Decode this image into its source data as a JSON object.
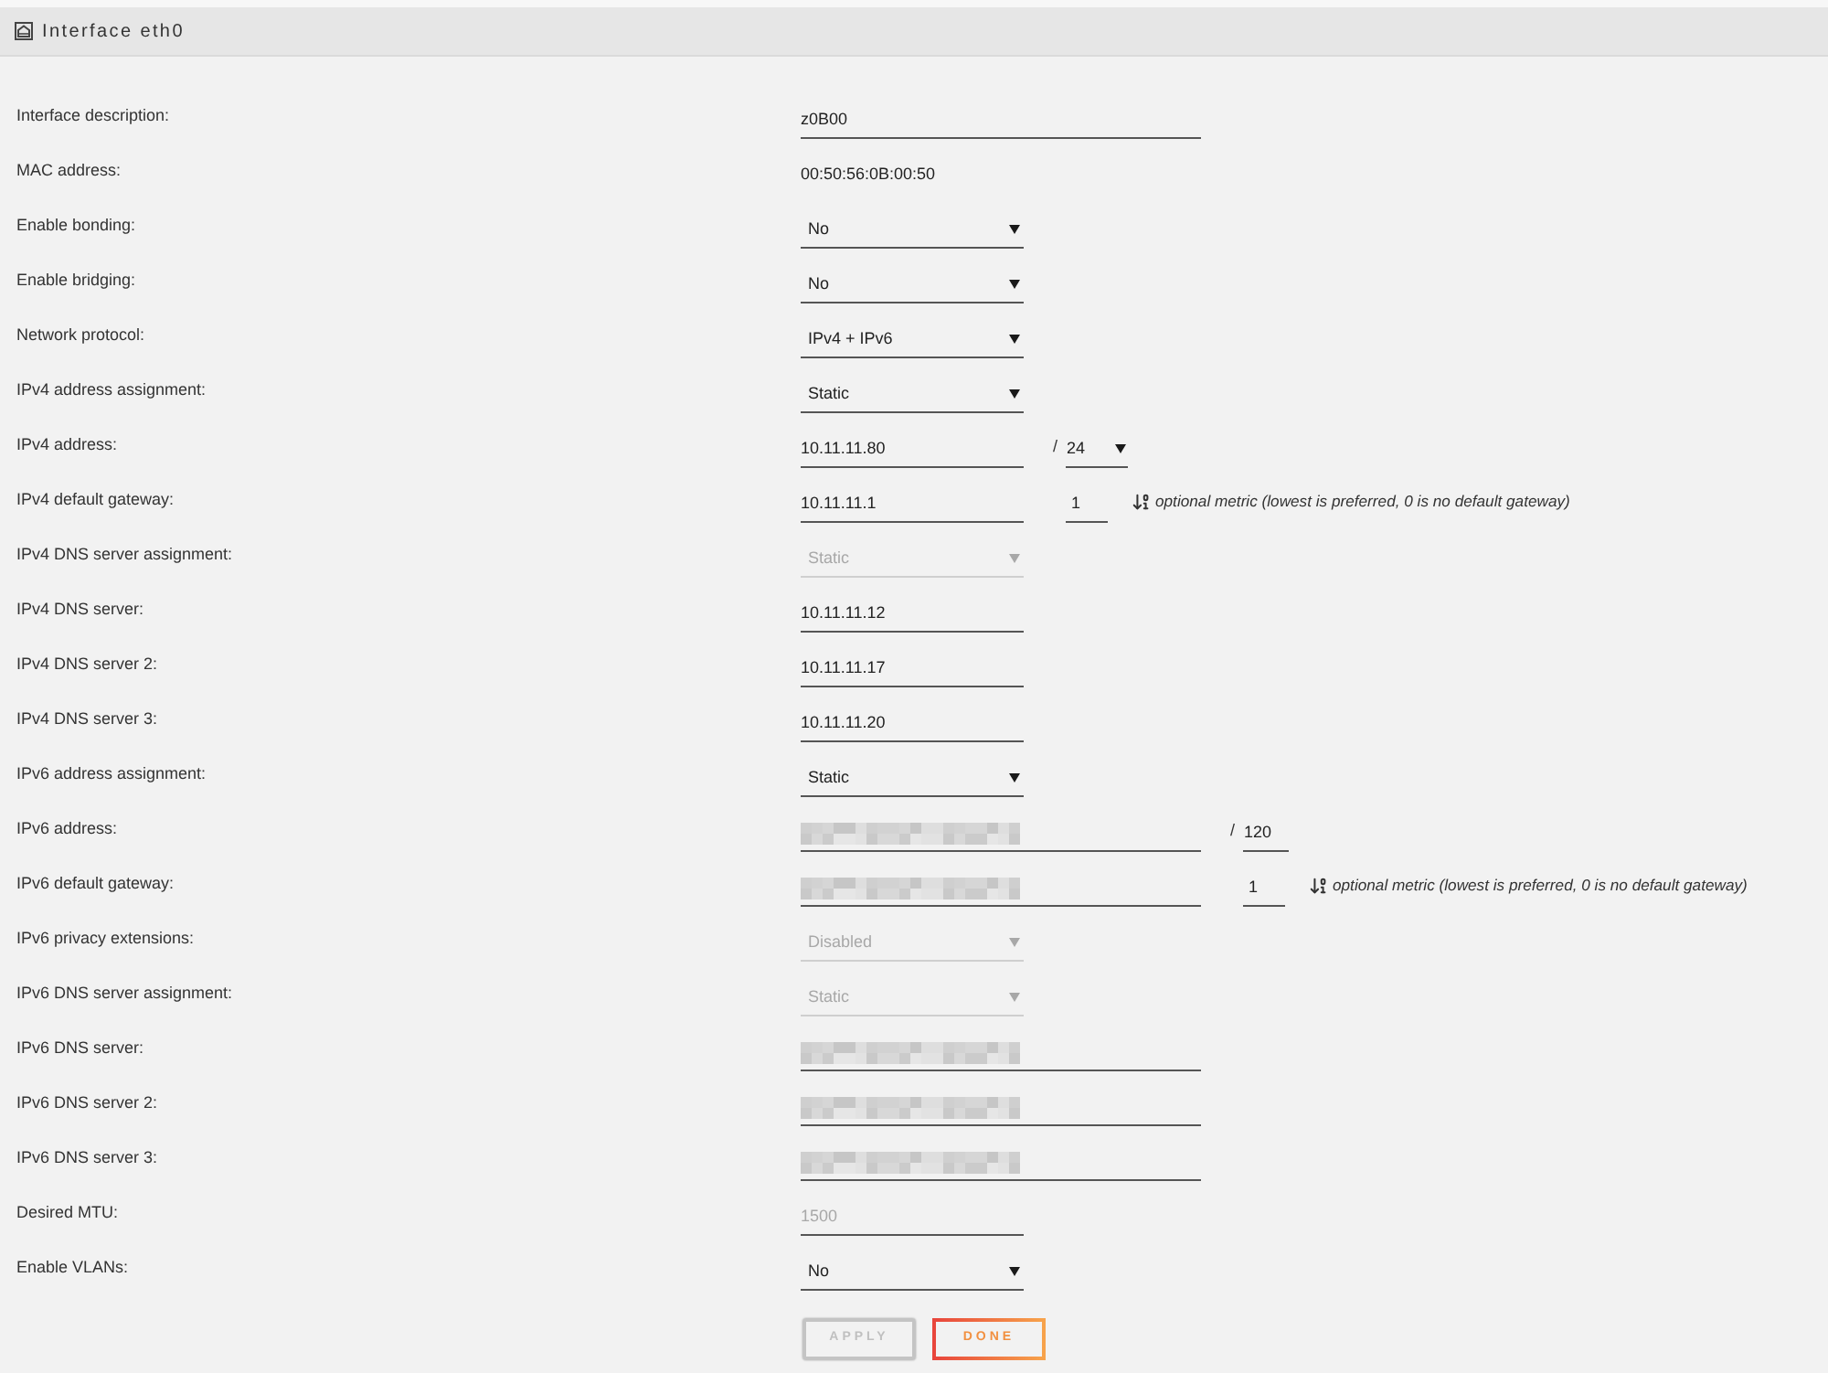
{
  "panel": {
    "title": "Interface eth0"
  },
  "rows": [
    {
      "label": "Interface description:",
      "field": {
        "kind": "wideinput",
        "value": "z0B00",
        "disabled": false
      }
    },
    {
      "label": "MAC address:",
      "field": {
        "kind": "static",
        "value": "00:50:56:0B:00:50",
        "disabled": false
      }
    },
    {
      "label": "Enable bonding:",
      "field": {
        "kind": "select",
        "value": "No",
        "disabled": false
      }
    },
    {
      "label": "Enable bridging:",
      "field": {
        "kind": "select",
        "value": "No",
        "disabled": false
      }
    },
    {
      "label": "Network protocol:",
      "field": {
        "kind": "select",
        "value": "IPv4 + IPv6",
        "disabled": false
      }
    },
    {
      "label": "IPv4 address assignment:",
      "field": {
        "kind": "select",
        "value": "Static",
        "disabled": false
      }
    },
    {
      "label": "IPv4 address:",
      "field": {
        "kind": "input",
        "value": "10.11.11.80",
        "disabled": false
      },
      "prefix": {
        "separator": "/",
        "kind": "select",
        "value": "24"
      }
    },
    {
      "label": "IPv4 default gateway:",
      "field": {
        "kind": "input",
        "value": "10.11.11.1",
        "disabled": false
      },
      "metric": {
        "value": "1",
        "hint": "optional metric (lowest is preferred, 0 is no default gateway)"
      }
    },
    {
      "label": "IPv4 DNS server assignment:",
      "field": {
        "kind": "select",
        "value": "Static",
        "disabled": true
      }
    },
    {
      "label": "IPv4 DNS server:",
      "field": {
        "kind": "input",
        "value": "10.11.11.12",
        "disabled": false
      }
    },
    {
      "label": "IPv4 DNS server 2:",
      "field": {
        "kind": "input",
        "value": "10.11.11.17",
        "disabled": false
      }
    },
    {
      "label": "IPv4 DNS server 3:",
      "field": {
        "kind": "input",
        "value": "10.11.11.20",
        "disabled": false
      }
    },
    {
      "label": "IPv6 address assignment:",
      "field": {
        "kind": "select",
        "value": "Static",
        "disabled": false
      }
    },
    {
      "label": "IPv6 address:",
      "field": {
        "kind": "wideinput",
        "redacted": true,
        "disabled": false
      },
      "prefix": {
        "separator": "/",
        "kind": "input",
        "value": "120"
      }
    },
    {
      "label": "IPv6 default gateway:",
      "field": {
        "kind": "wideinput",
        "redacted": true,
        "disabled": false
      },
      "metric": {
        "value": "1",
        "hint": "optional metric (lowest is preferred, 0 is no default gateway)"
      }
    },
    {
      "label": "IPv6 privacy extensions:",
      "field": {
        "kind": "select",
        "value": "Disabled",
        "disabled": true
      }
    },
    {
      "label": "IPv6 DNS server assignment:",
      "field": {
        "kind": "select",
        "value": "Static",
        "disabled": true
      }
    },
    {
      "label": "IPv6 DNS server:",
      "field": {
        "kind": "wideinput",
        "redacted": true,
        "disabled": false
      }
    },
    {
      "label": "IPv6 DNS server 2:",
      "field": {
        "kind": "wideinput",
        "redacted": true,
        "disabled": false
      }
    },
    {
      "label": "IPv6 DNS server 3:",
      "field": {
        "kind": "wideinput",
        "redacted": true,
        "disabled": false
      }
    },
    {
      "label": "Desired MTU:",
      "field": {
        "kind": "input",
        "placeholder": "1500",
        "disabled": false
      }
    },
    {
      "label": "Enable VLANs:",
      "field": {
        "kind": "select",
        "value": "No",
        "disabled": false
      }
    }
  ],
  "buttons": [
    {
      "label": "APPLY",
      "disabled": true
    },
    {
      "label": "DONE",
      "disabled": false
    }
  ]
}
